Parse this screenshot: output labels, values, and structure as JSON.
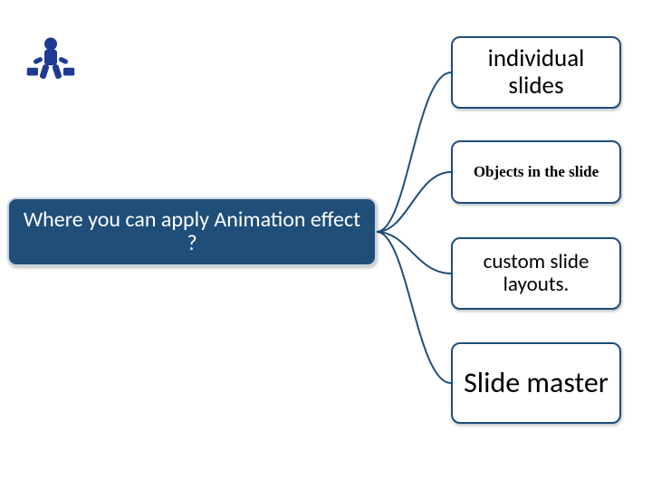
{
  "logo": {
    "name": "presenter-icon"
  },
  "main": {
    "question": "Where you can apply Animation effect ?"
  },
  "items": [
    {
      "label": "individual slides"
    },
    {
      "label": "Objects in the slide"
    },
    {
      "label": "custom slide layouts."
    },
    {
      "label": "Slide master"
    }
  ],
  "colors": {
    "brand": "#1f4e79",
    "border": "#c9d6e4"
  }
}
